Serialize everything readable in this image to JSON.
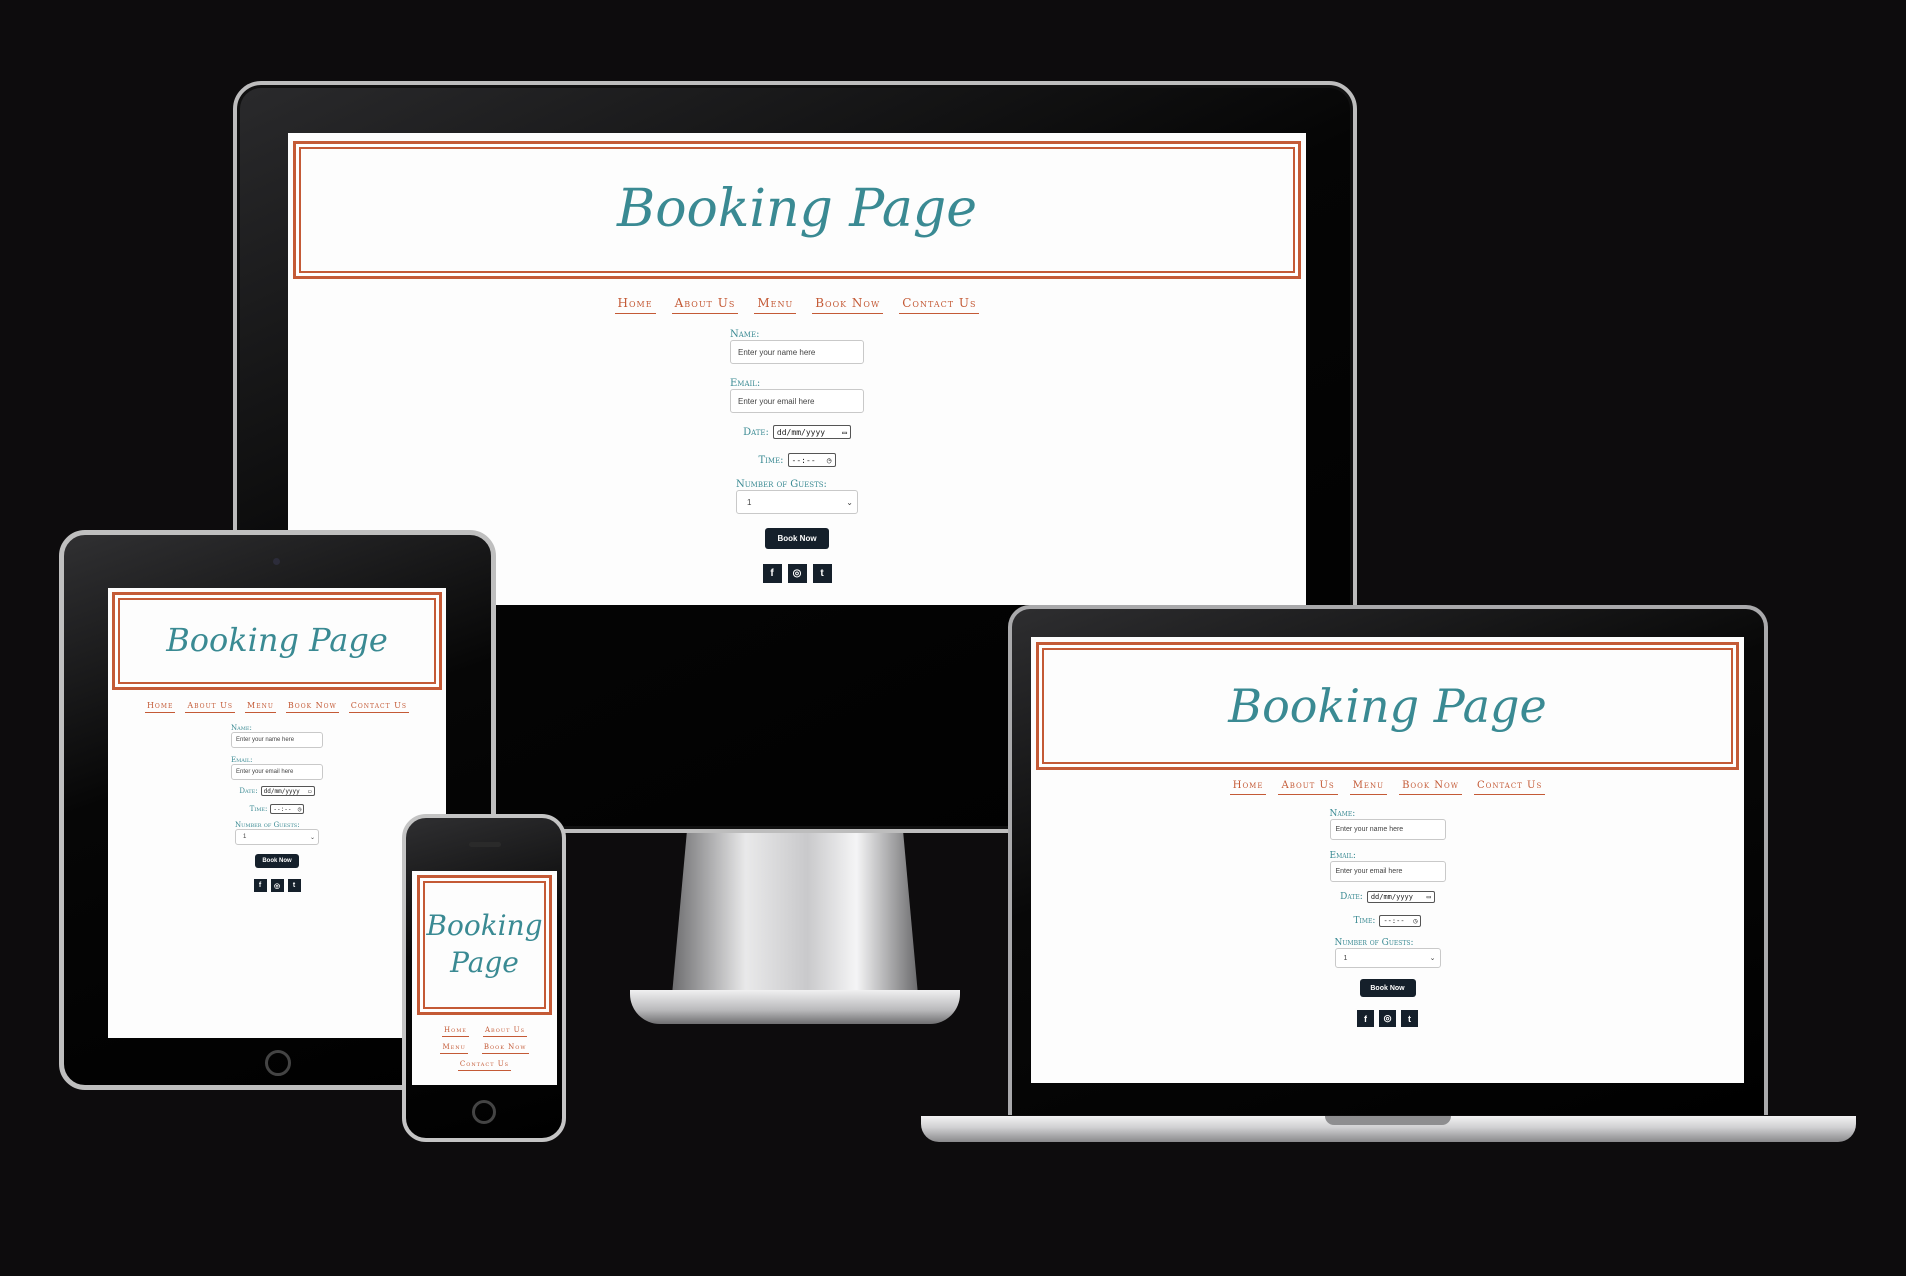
{
  "page": {
    "title": "Booking Page",
    "title_line1": "Booking",
    "title_line2": "Page",
    "nav": [
      "Home",
      "About Us",
      "Menu",
      "Book Now",
      "Contact Us"
    ],
    "form": {
      "name_label": "Name:",
      "name_placeholder": "Enter your name here",
      "email_label": "Email:",
      "email_placeholder": "Enter your email here",
      "date_label": "Date:",
      "date_value": "dd/mm/yyyy",
      "time_label": "Time:",
      "time_value": "--:--",
      "guests_label": "Number of Guests:",
      "guests_value": "1",
      "submit_label": "Book Now"
    },
    "social": {
      "facebook": "f",
      "instagram": "◎",
      "twitter": "t"
    }
  },
  "colors": {
    "accent_teal": "#3a8a93",
    "accent_rust": "#c45a36",
    "button_dark": "#15202b",
    "background": "#0d0c0d"
  }
}
